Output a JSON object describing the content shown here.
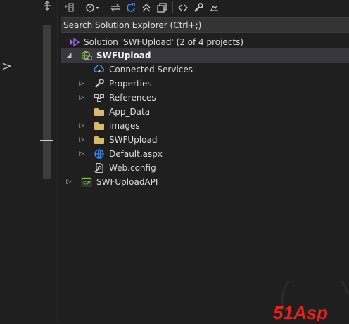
{
  "left": {
    "chevron": ">"
  },
  "toolbar": {
    "icons": [
      "vs-switch-views-icon",
      "history-icon",
      "sync-icon",
      "refresh-icon",
      "collapse-all-icon",
      "copy-icon",
      "code-view-icon",
      "wrench-icon",
      "preview-icon"
    ]
  },
  "search": {
    "placeholder": "Search Solution Explorer (Ctrl+;)"
  },
  "tree": {
    "solution_label": "Solution 'SWFUpload' (2 of 4 projects)",
    "project_label": "SWFUpload",
    "items": [
      {
        "label": "Connected Services"
      },
      {
        "label": "Properties"
      },
      {
        "label": "References"
      },
      {
        "label": "App_Data"
      },
      {
        "label": "images"
      },
      {
        "label": "SWFUpload"
      },
      {
        "label": "Default.aspx"
      },
      {
        "label": "Web.config"
      }
    ],
    "api_project_label": "SWFUploadAPI"
  },
  "watermark": {
    "text": "51Asp"
  },
  "colors": {
    "background": "#1f1f1f",
    "selection": "#37373d",
    "folder": "#dcb967",
    "accent_blue": "#3794ff",
    "csharp_green": "#8bc34a",
    "watermark_red": "#e0241b"
  }
}
